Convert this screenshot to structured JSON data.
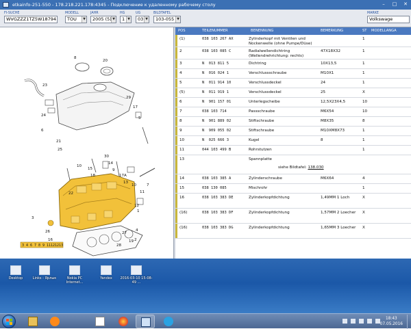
{
  "window": {
    "title": "etkainfo-251-550 - 178.218.221.178:4345 - Подключение к удаленному рабочему столу"
  },
  "filters": {
    "fi_suche": {
      "label": "FI-SUCHE",
      "value": "WVGZZZ1TZ5W18794"
    },
    "modell": {
      "label": "MODELL",
      "value": "TOU"
    },
    "jahr": {
      "label": "JAHR",
      "value": "2005 (5)"
    },
    "hg": {
      "label": "HG",
      "value": "1"
    },
    "ug": {
      "label": "UG",
      "value": "03"
    },
    "bildtafel": {
      "label": "BILDTAFEL",
      "value": "103-055"
    },
    "marke": {
      "label": "MARKE",
      "value": "Volkswage"
    }
  },
  "diagram": {
    "labels": [
      "23",
      "8",
      "20",
      "29",
      "17",
      "5",
      "24",
      "6",
      "21",
      "25",
      "10",
      "15",
      "18",
      "30",
      "14",
      "9",
      "17A",
      "13",
      "10",
      "7",
      "11",
      "22",
      "12",
      "4",
      "19",
      "28",
      "27",
      "26",
      "16",
      "3",
      "1",
      "2"
    ],
    "footer": [
      "3",
      "4",
      "6",
      "7",
      "8",
      "9",
      "11",
      "12",
      "12",
      "13"
    ]
  },
  "table": {
    "headers": {
      "pos": "POS",
      "teilenummer": "TEILENUMMER",
      "benennung": "BENENNUNG",
      "bemerkung": "BEMERKUNG",
      "st": "ST",
      "modellangabe": "MODELLANGA"
    },
    "rows": [
      {
        "pos": "(1)",
        "teil": "038 103 267 AX",
        "ben": "Zylinderkopf mit Ventilen und Nockenwelle (ohne Pumpe/Düse)",
        "bem": "",
        "st": "1"
      },
      {
        "pos": "2",
        "teil": "038 103 085 C",
        "ben": "Radialwellendichtring (Wellendrehrichtung: rechts)",
        "bem": "47X18X32",
        "st": "1"
      },
      {
        "pos": "3",
        "teil": "N  013 811 5",
        "ben": "Dichtring",
        "bem": "10X13,5",
        "st": "1"
      },
      {
        "pos": "4",
        "teil": "N  016 024 1",
        "ben": "Verschlussschraube",
        "bem": "M10X1",
        "st": "1"
      },
      {
        "pos": "5",
        "teil": "N  011 914 10",
        "ben": "Verschlussdeckel",
        "bem": "24",
        "st": "1"
      },
      {
        "pos": "(5)",
        "teil": "N  011 919 1",
        "ben": "Verschlussdeckel",
        "bem": "25",
        "st": "X"
      },
      {
        "pos": "6",
        "teil": "N  901 157 01",
        "ben": "Unterlegscheibe",
        "bem": "12,5X23X4,5",
        "st": "10"
      },
      {
        "pos": "7",
        "teil": "038 103 714",
        "ben": "Passschraube",
        "bem": "M6X54",
        "st": "10"
      },
      {
        "pos": "8",
        "teil": "N  901 889 02",
        "ben": "Stiftschraube",
        "bem": "M8X35",
        "st": "8"
      },
      {
        "pos": "9",
        "teil": "N  909 055 02",
        "ben": "Stiftschraube",
        "bem": "M10XM8X73",
        "st": "1"
      },
      {
        "pos": "10",
        "teil": "N  025 666 3",
        "ben": "Kugel",
        "bem": "8",
        "st": "1"
      },
      {
        "pos": "11",
        "teil": "044 103 499 B",
        "ben": "Rohrstutzen",
        "bem": "",
        "st": "1"
      },
      {
        "pos": "13",
        "teil": "",
        "ben": "Spannplatte",
        "bem_pre": "siehe Bildtafel:",
        "bem": "138.030",
        "st": ""
      },
      {
        "pos": "14",
        "teil": "038 103 385 A",
        "ben": "Zylinderschraube",
        "bem": "M6X64",
        "st": "4"
      },
      {
        "pos": "15",
        "teil": "038 130 085",
        "ben": "Mischrohr",
        "bem": "",
        "st": "1"
      },
      {
        "pos": "16",
        "teil": "038 103 383 DE",
        "ben": "Zylinderkopfdichtung",
        "bem": "1,49MM 1 Loch",
        "st": "X"
      },
      {
        "pos": "(16)",
        "teil": "038 103 383 DF",
        "ben": "Zylinderkopfdichtung",
        "bem": "1,57MM 2 Loecher",
        "st": "X"
      },
      {
        "pos": "(16)",
        "teil": "038 103 383 DG",
        "ben": "Zylinderkopfdichtung",
        "bem": "1,65MM 3 Loecher",
        "st": "X"
      }
    ]
  },
  "desktop_icons": [
    {
      "label": "Desktop"
    },
    {
      "label": "Links - Ярлык"
    },
    {
      "label": "Nokia PC Internet..."
    },
    {
      "label": "Yandex"
    },
    {
      "label": "2016-03-10 15-08-49 ..."
    }
  ],
  "taskbar": {
    "apps": [
      "explorer-icon",
      "media-player-icon",
      "paint-icon",
      "firefox-icon",
      "remote-desktop-icon",
      "skype-icon"
    ],
    "clock_time": "18:43",
    "clock_date": "07.05.2016"
  },
  "colors": {
    "header_blue": "#4a79c0",
    "row_marker": "#c9b73a",
    "part_yellow": "#f2c13a"
  }
}
